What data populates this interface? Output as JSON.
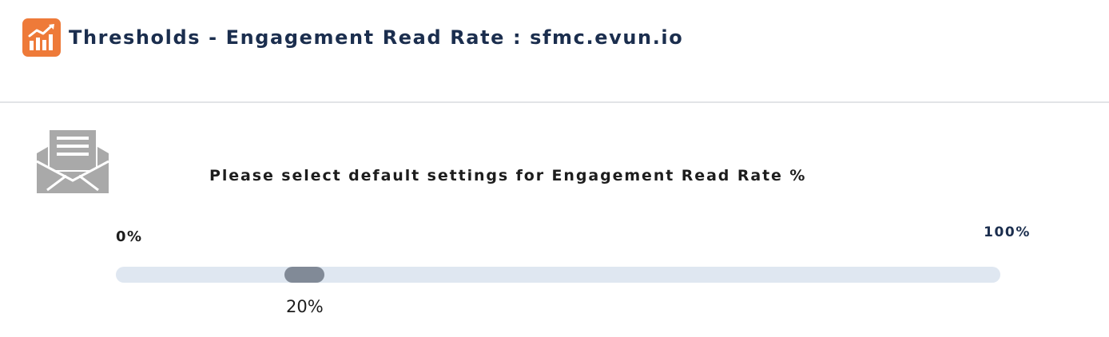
{
  "header": {
    "title": "Thresholds - Engagement Read Rate : sfmc.evun.io",
    "app_icon": "bar-chart-trend-icon",
    "accent_color": "#ee7a39"
  },
  "main": {
    "icon": "open-envelope-icon",
    "instruction": "Please select default settings for Engagement Read Rate %",
    "slider": {
      "min_label": "0%",
      "max_label": "100%",
      "value_percent": 20,
      "value_label": "20%"
    }
  }
}
